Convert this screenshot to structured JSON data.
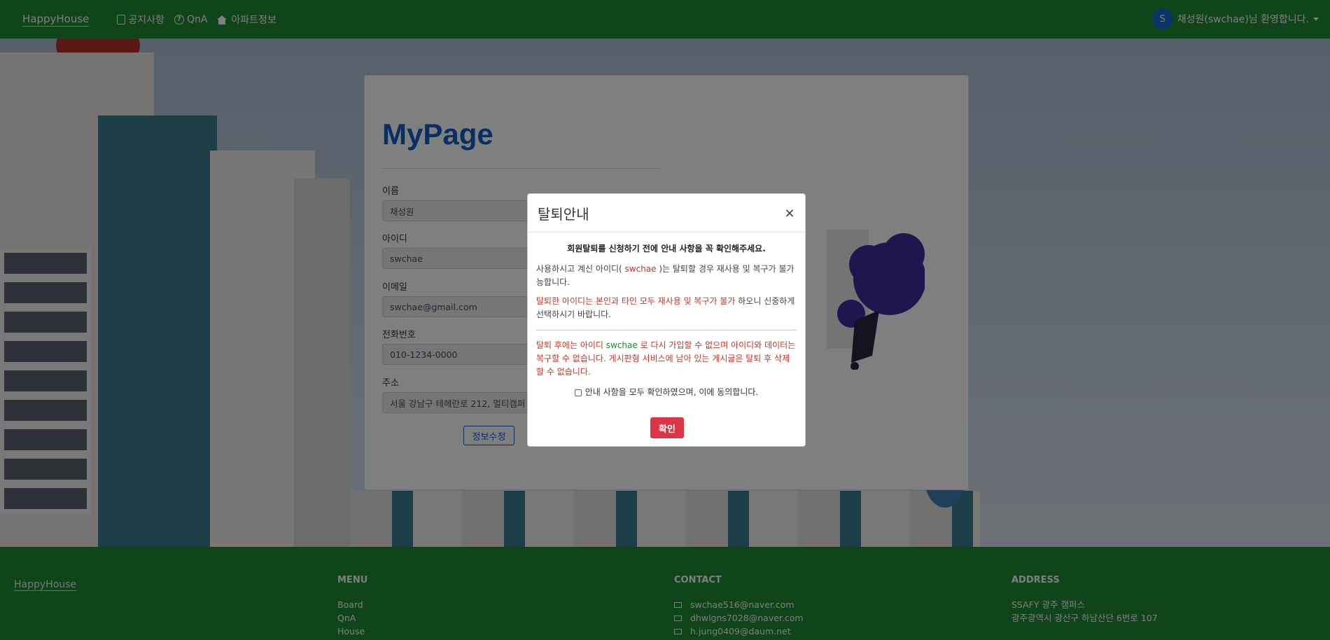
{
  "navbar": {
    "brand": "HappyHouse",
    "items": [
      {
        "label": "공지사항",
        "icon": "square-icon"
      },
      {
        "label": "QnA",
        "icon": "question-circle-icon"
      },
      {
        "label": "아파트정보",
        "icon": "house-icon"
      }
    ],
    "user_initial": "S",
    "user_greeting": "채성원(swchae)님 환영합니다."
  },
  "mypage": {
    "title": "MyPage",
    "fields": [
      {
        "label": "이름",
        "value": "채성원"
      },
      {
        "label": "아이디",
        "value": "swchae"
      },
      {
        "label": "이메일",
        "value": "swchae@gmail.com"
      },
      {
        "label": "전화번호",
        "value": "010-1234-0000"
      },
      {
        "label": "주소",
        "value": "서울 강남구 테헤란로 212, 멀티캠퍼"
      }
    ],
    "edit_label": "정보수정"
  },
  "modal": {
    "title": "탈퇴안내",
    "close": "×",
    "lead": "회원탈퇴를 신청하기 전에 안내 사항을 꼭 확인해주세요.",
    "p1_before": "사용하시고 계신 아이디(",
    "p1_id": " swchae ",
    "p1_after": ")는 탈퇴할 경우 재사용 및 복구가 불가능합니다.",
    "p2_red": "탈퇴한 아이디는 본인과 타인 모두 재사용 및 복구가 불가",
    "p2_after": " 하오니 신중하게 선택하시기 바랍니다.",
    "p3_before": "탈퇴 후에는 아이디 ",
    "p3_id": "swchae",
    "p3_after": " 로 다시 가입할 수 없으며 아이디와 데이터는 복구할 수 없습니다. 게시판형 서비스에 남아 있는 게시글은 탈퇴 후 삭제할 수 없습니다.",
    "agree": "안내 사항을 모두 확인하였으며, 이에 동의합니다.",
    "confirm": "확인"
  },
  "footer": {
    "brand": "HappyHouse",
    "menu_head": "MENU",
    "menu_items": [
      "Board",
      "QnA",
      "House"
    ],
    "contact_head": "CONTACT",
    "contacts": [
      "swchae516@naver.com",
      "dhwlgns7028@naver.com",
      "h.jung0409@daum.net"
    ],
    "address_head": "ADDRESS",
    "address_lines": [
      "SSAFY 광주 캠퍼스",
      "광주광역시 광산구 하남산단 6번로 107"
    ]
  }
}
